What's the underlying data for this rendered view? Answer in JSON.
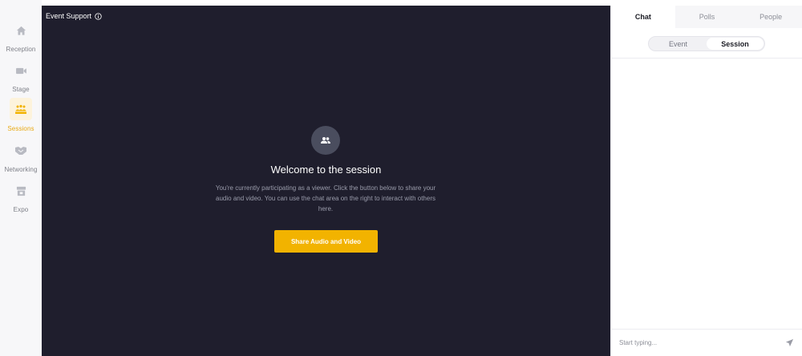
{
  "nav": {
    "items": [
      {
        "label": "Reception",
        "icon": "home-icon"
      },
      {
        "label": "Stage",
        "icon": "video-camera-icon"
      },
      {
        "label": "Sessions",
        "icon": "sessions-people-icon",
        "active": true
      },
      {
        "label": "Networking",
        "icon": "handshake-icon"
      },
      {
        "label": "Expo",
        "icon": "booth-icon"
      }
    ],
    "active_color": "#e8a913"
  },
  "stage": {
    "event_title": "Event Support",
    "welcome_title": "Welcome to the session",
    "welcome_text": "You're currently participating as a viewer. Click the button below to share your audio and video. You can use the chat area on the right to interact with others here.",
    "share_button_label": "Share Audio and Video",
    "button_color": "#f2b300",
    "background": "#1f1e2d"
  },
  "panel": {
    "tabs": [
      {
        "label": "Chat",
        "active": true
      },
      {
        "label": "Polls"
      },
      {
        "label": "People"
      }
    ],
    "segments": [
      {
        "label": "Event"
      },
      {
        "label": "Session",
        "active": true
      }
    ],
    "input_placeholder": "Start typing..."
  }
}
